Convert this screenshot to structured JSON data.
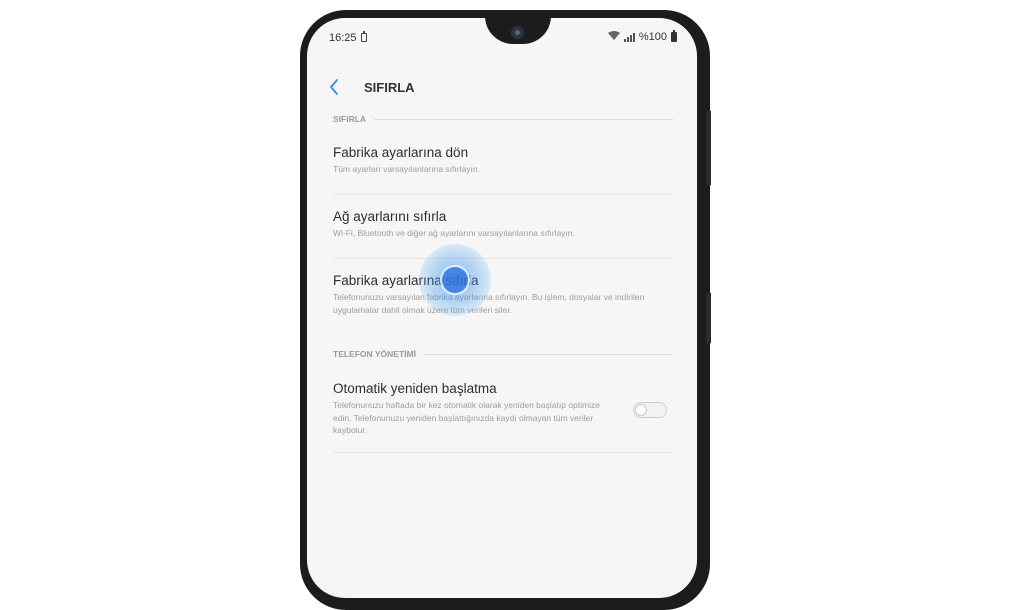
{
  "status_bar": {
    "time": "16:25",
    "battery_text": "%100",
    "icons": [
      "battery-saver-icon",
      "wifi-icon",
      "signal-icon",
      "battery-icon"
    ]
  },
  "app_bar": {
    "back_icon": "back-arrow-icon",
    "title": "SIFIRLA"
  },
  "sections": [
    {
      "header": "SIFIRLA",
      "items": [
        {
          "title": "Fabrika ayarlarına dön",
          "description": "Tüm ayarları varsayılanlarına sıfırlayın."
        },
        {
          "title": "Ağ ayarlarını sıfırla",
          "description": "Wi-Fi, Bluetooth ve diğer ağ ayarlarını varsayılanlarına sıfırlayın."
        },
        {
          "title": "Fabrika ayarlarına sıfırla",
          "description": "Telefonunuzu varsayılan fabrika ayarlarına sıfırlayın. Bu işlem, dosyalar ve indirilen uygulamalar dahil olmak üzere tüm verileri siler."
        }
      ]
    },
    {
      "header": "TELEFON YÖNETİMİ",
      "items": [
        {
          "title": "Otomatik yeniden başlatma",
          "description": "Telefonunuzu haftada bir kez otomatik olarak yeniden başlatıp optimize edin. Telefonunuzu yeniden başlattığınızda kaydı olmayan tüm veriler kaybolur.",
          "toggle_on": false
        }
      ]
    }
  ],
  "colors": {
    "accent": "#3a8fd9",
    "tap_highlight": "#2f7fe0",
    "screen_background": "#f6f6f6",
    "phone_frame": "#1c1c1e"
  }
}
